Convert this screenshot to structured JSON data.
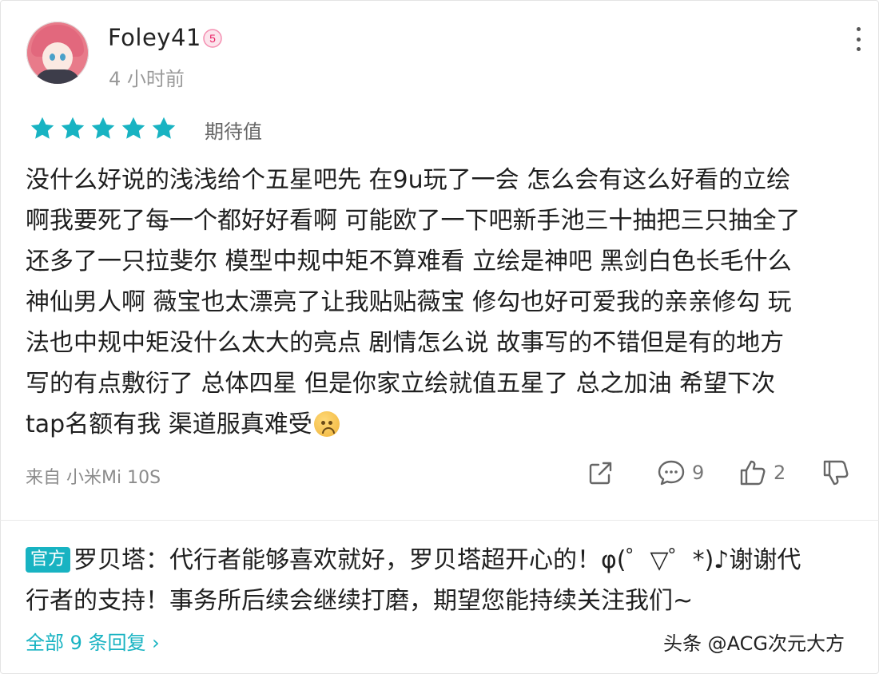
{
  "post": {
    "username": "Foley41",
    "level": "5",
    "time": "4 小时前",
    "rating": 5,
    "rating_max": 5,
    "rating_label": "期待值",
    "review_lines": [
      "没什么好说的浅浅给个五星吧先 在9u玩了一会 怎么会有这么好看的立绘",
      "啊我要死了每一个都好好看啊 可能欧了一下吧新手池三十抽把三只抽全了",
      "还多了一只拉斐尔 模型中规中矩不算难看 立绘是神吧 黑剑白色长毛什么",
      "神仙男人啊 薇宝也太漂亮了让我贴贴薇宝 修勾也好可爱我的亲亲修勾 玩",
      "法也中规中矩没什么太大的亮点 剧情怎么说 故事写的不错但是有的地方",
      "写的有点敷衍了 总体四星 但是你家立绘就值五星了 总之加油 希望下次",
      "tap名额有我 渠道服真难受"
    ],
    "device": "来自 小米Mi 10S",
    "comment_count": "9",
    "like_count": "2"
  },
  "reply": {
    "badge": "官方",
    "lines": [
      "罗贝塔：代行者能够喜欢就好，罗贝塔超开心的！φ(゜▽゜*)♪谢谢代",
      "行者的支持！事务所后续会继续打磨，期望您能持续关注我们~"
    ],
    "all_replies": "全部 9 条回复 ›"
  },
  "watermark": "头条 @ACG次元大方",
  "colors": {
    "accent": "#18b3c2",
    "text": "#1f1f1f",
    "muted": "#9a9a9a"
  },
  "icons": {
    "more": "more-vertical-icon",
    "share": "share-icon",
    "comment": "comment-icon",
    "like": "thumbs-up-icon",
    "dislike": "thumbs-down-icon",
    "emoji": "crying-face-emoji"
  }
}
